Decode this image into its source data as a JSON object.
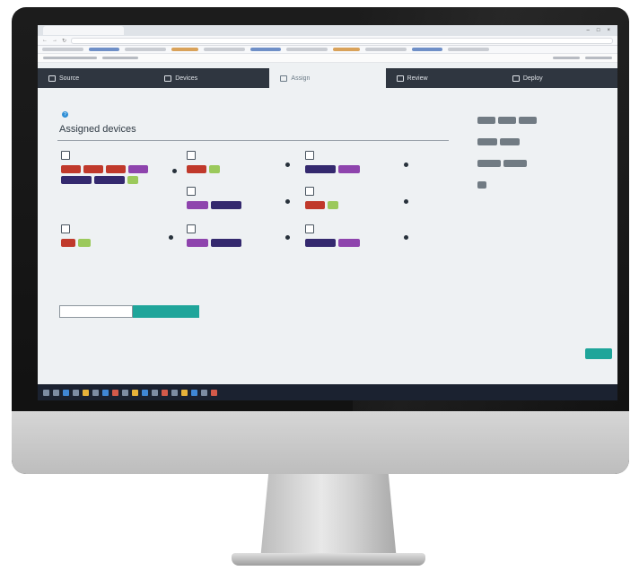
{
  "browser": {
    "tab_title": "",
    "url": "",
    "nav_glyphs": [
      "←",
      "→",
      "↻"
    ],
    "window_controls": [
      "–",
      "□",
      "×"
    ]
  },
  "app_nav": {
    "tabs": [
      {
        "label": "Source"
      },
      {
        "label": "Devices"
      },
      {
        "label": "Assign"
      },
      {
        "label": "Review"
      },
      {
        "label": "Deploy"
      }
    ]
  },
  "main": {
    "hint": "",
    "section_title": "Assigned devices",
    "devices": [
      {
        "label": "",
        "chips": [
          {
            "text": "",
            "color": "#c0392b"
          },
          {
            "text": "",
            "color": "#c0392b"
          },
          {
            "text": "",
            "color": "#c0392b"
          },
          {
            "text": "",
            "color": "#8e44ad"
          },
          {
            "text": "",
            "color": "#34296e"
          },
          {
            "text": "",
            "color": "#34296e"
          },
          {
            "text": "",
            "color": "#9bc95b"
          }
        ]
      },
      {
        "label": "",
        "chips": [
          {
            "text": "",
            "color": "#c0392b"
          },
          {
            "text": "",
            "color": "#9bc95b"
          }
        ]
      },
      {
        "label": "",
        "chips": [
          {
            "text": "",
            "color": "#34296e"
          },
          {
            "text": "",
            "color": "#8e44ad"
          }
        ]
      },
      {
        "label": "",
        "chips": [
          {
            "text": "",
            "color": "#8e44ad"
          },
          {
            "text": "",
            "color": "#34296e"
          }
        ]
      },
      {
        "label": "",
        "chips": [
          {
            "text": "",
            "color": "#c0392b"
          },
          {
            "text": "",
            "color": "#9bc95b"
          }
        ]
      },
      {
        "label": "",
        "chips": [
          {
            "text": "",
            "color": "#c0392b"
          },
          {
            "text": "",
            "color": "#9bc95b"
          }
        ]
      },
      {
        "label": "",
        "chips": [
          {
            "text": "",
            "color": "#8e44ad"
          },
          {
            "text": "",
            "color": "#34296e"
          }
        ]
      },
      {
        "label": "",
        "chips": [
          {
            "text": "",
            "color": "#34296e"
          },
          {
            "text": "",
            "color": "#8e44ad"
          }
        ]
      }
    ],
    "buttons": {
      "secondary": "",
      "primary": ""
    }
  },
  "right_panel": {
    "description": "",
    "groups": [
      {
        "label": "",
        "chips": [
          "",
          "",
          ""
        ]
      },
      {
        "label": "",
        "chips": [
          "",
          ""
        ]
      },
      {
        "label": "",
        "chips": [
          "",
          ""
        ]
      },
      {
        "label": "",
        "chips": [
          ""
        ]
      }
    ]
  },
  "corner_button": "",
  "taskbar": {
    "clock": ""
  },
  "colors": {
    "accent": "#1fa59a",
    "nav_bg": "#2f3640",
    "chip_red": "#c0392b",
    "chip_purple": "#8e44ad",
    "chip_navy": "#34296e",
    "chip_green": "#9bc95b"
  }
}
